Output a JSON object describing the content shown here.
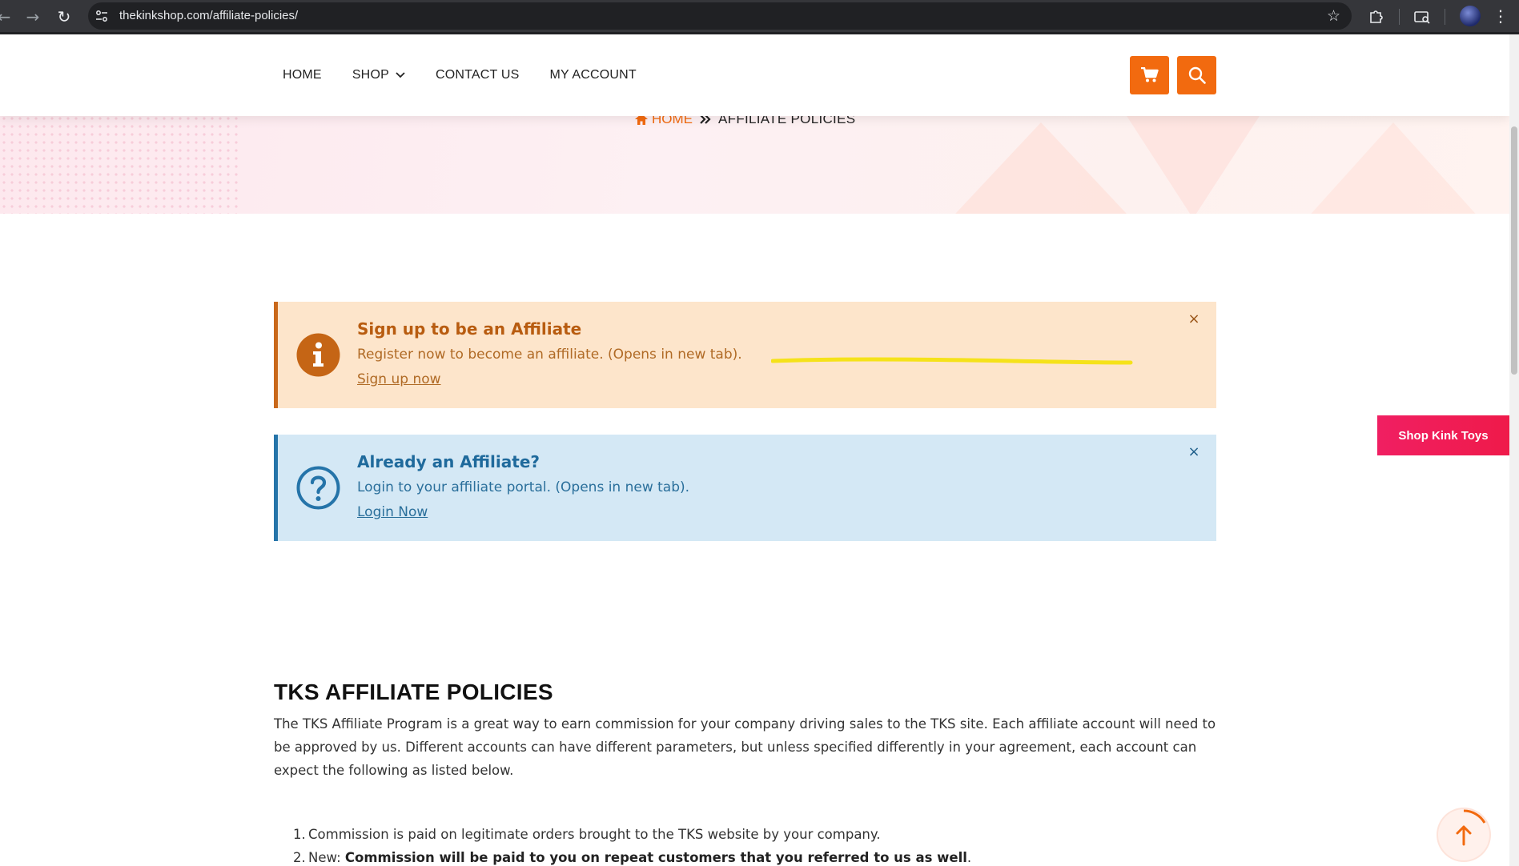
{
  "browser": {
    "url": "thekinkshop.com/affiliate-policies/"
  },
  "header": {
    "menu": [
      {
        "label": "HOME"
      },
      {
        "label": "SHOP"
      },
      {
        "label": "CONTACT US"
      },
      {
        "label": "MY ACCOUNT"
      }
    ],
    "accent_color": "#f26a0f"
  },
  "breadcrumb": {
    "home": "HOME",
    "current": "AFFILIATE POLICIES"
  },
  "alerts": {
    "signup": {
      "title": "Sign up to be an Affiliate",
      "text": "Register now to become an affiliate. (Opens in new tab).",
      "link": "Sign up now",
      "close": "×",
      "icon": "info-icon",
      "color": "#c9681a"
    },
    "login": {
      "title": "Already an Affiliate?",
      "text": "Login to your affiliate portal. (Opens in new tab).",
      "link": "Login Now",
      "close": "×",
      "icon": "question-icon",
      "color": "#2574a9"
    }
  },
  "content": {
    "title": "TKS AFFILIATE POLICIES",
    "intro": "The TKS Affiliate Program is a great way to earn commission for your company driving sales to the TKS site. Each affiliate account will need to be approved by us. Different accounts can have different parameters, but unless specified differently in your agreement, each account can expect the following as listed below.",
    "list": [
      {
        "num": "1.",
        "text": "Commission is paid on legitimate orders brought to the TKS website by your company."
      },
      {
        "num": "2.",
        "prefix": "New: ",
        "bold": "Commission will be paid to you on repeat customers that you referred to us as well",
        "suffix": "."
      }
    ]
  },
  "floating": {
    "shop_button": "Shop Kink Toys",
    "shop_color": "#f01f62"
  }
}
